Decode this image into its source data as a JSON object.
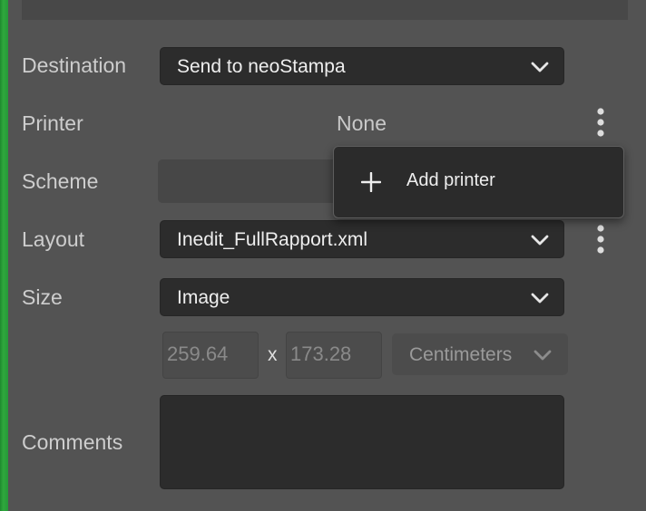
{
  "form": {
    "destination": {
      "label": "Destination",
      "value": "Send to neoStampa"
    },
    "printer": {
      "label": "Printer",
      "value": "None"
    },
    "scheme": {
      "label": "Scheme"
    },
    "layout": {
      "label": "Layout",
      "value": "Inedit_FullRapport.xml"
    },
    "size": {
      "label": "Size",
      "value": "Image",
      "width": "259.64",
      "separator": "x",
      "height": "173.28",
      "unit": "Centimeters"
    },
    "comments": {
      "label": "Comments",
      "value": ""
    }
  },
  "printer_menu": {
    "items": [
      {
        "label": "Add printer",
        "icon": "plus-icon"
      }
    ]
  },
  "colors": {
    "panel_bg": "#535353",
    "field_bg": "#2c2c2c",
    "menu_bg": "#2b2b2b",
    "label_text": "#cdcdcd",
    "value_text": "#eeeeee",
    "edge_green": "#2fa83c"
  }
}
